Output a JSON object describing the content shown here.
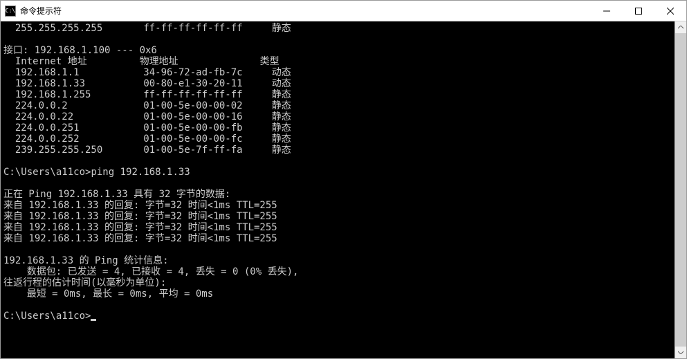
{
  "window": {
    "title": "命令提示符",
    "icon_text": "C:\\"
  },
  "arp_top": {
    "ip": "255.255.255.255",
    "mac": "ff-ff-ff-ff-ff-ff",
    "type": "静态"
  },
  "interface": {
    "header": "接口: 192.168.1.100 --- 0x6",
    "col_ip": "Internet 地址",
    "col_mac": "物理地址",
    "col_type": "类型",
    "entries": [
      {
        "ip": "192.168.1.1",
        "mac": "34-96-72-ad-fb-7c",
        "type": "动态"
      },
      {
        "ip": "192.168.1.33",
        "mac": "00-80-e1-30-20-11",
        "type": "动态"
      },
      {
        "ip": "192.168.1.255",
        "mac": "ff-ff-ff-ff-ff-ff",
        "type": "静态"
      },
      {
        "ip": "224.0.0.2",
        "mac": "01-00-5e-00-00-02",
        "type": "静态"
      },
      {
        "ip": "224.0.0.22",
        "mac": "01-00-5e-00-00-16",
        "type": "静态"
      },
      {
        "ip": "224.0.0.251",
        "mac": "01-00-5e-00-00-fb",
        "type": "静态"
      },
      {
        "ip": "224.0.0.252",
        "mac": "01-00-5e-00-00-fc",
        "type": "静态"
      },
      {
        "ip": "239.255.255.250",
        "mac": "01-00-5e-7f-ff-fa",
        "type": "静态"
      }
    ]
  },
  "prompt1": {
    "path": "C:\\Users\\a11co>",
    "cmd": "ping 192.168.1.33"
  },
  "ping": {
    "header": "正在 Ping 192.168.1.33 具有 32 字节的数据:",
    "replies": [
      "来自 192.168.1.33 的回复: 字节=32 时间<1ms TTL=255",
      "来自 192.168.1.33 的回复: 字节=32 时间<1ms TTL=255",
      "来自 192.168.1.33 的回复: 字节=32 时间<1ms TTL=255",
      "来自 192.168.1.33 的回复: 字节=32 时间<1ms TTL=255"
    ],
    "stats_header": "192.168.1.33 的 Ping 统计信息:",
    "stats_packets": "    数据包: 已发送 = 4, 已接收 = 4, 丢失 = 0 (0% 丢失),",
    "rtt_header": "往返行程的估计时间(以毫秒为单位):",
    "rtt_values": "    最短 = 0ms, 最长 = 0ms, 平均 = 0ms"
  },
  "prompt2": {
    "path": "C:\\Users\\a11co>"
  }
}
